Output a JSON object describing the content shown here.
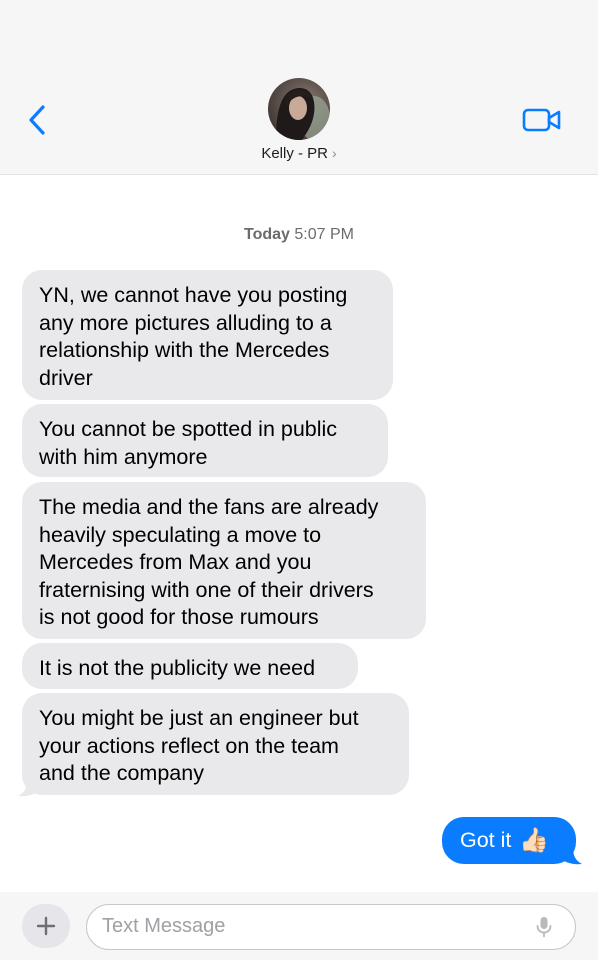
{
  "contact": {
    "name": "Kelly - PR",
    "chevron": "›"
  },
  "timestamp": {
    "day": "Today",
    "time": "5:07 PM"
  },
  "messages": {
    "received": [
      {
        "lines": [
          "YN, we cannot have you posting",
          "any more pictures alluding to a",
          "relationship with the Mercedes",
          "driver"
        ]
      },
      {
        "lines": [
          "You cannot be spotted in public",
          "with him anymore"
        ]
      },
      {
        "lines": [
          "The media and the fans are already",
          "heavily speculating a move to",
          "Mercedes from Max and you",
          "fraternising with one of their drivers",
          "is not good for those rumours"
        ]
      },
      {
        "lines": [
          "It is not the publicity we need"
        ]
      },
      {
        "lines": [
          "You might be just an engineer but",
          "your actions reflect on the team",
          "and the company"
        ]
      }
    ],
    "sent": {
      "text": "Got it",
      "emoji": "👍🏻"
    }
  },
  "input": {
    "placeholder": "Text Message",
    "plus": "+"
  },
  "colors": {
    "accent": "#0a7cff",
    "received_bubble": "#e9e9eb",
    "header_bg": "#f6f6f6"
  },
  "icons": [
    "back-chevron-icon",
    "video-camera-icon",
    "plus-icon",
    "microphone-icon"
  ]
}
